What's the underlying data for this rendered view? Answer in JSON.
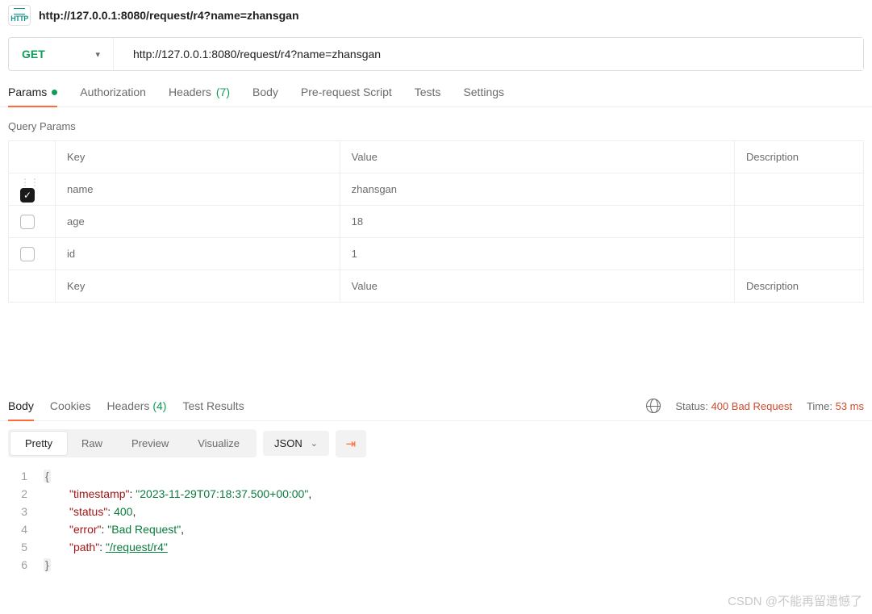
{
  "header": {
    "title_url": "http://127.0.0.1:8080/request/r4?name=zhansgan"
  },
  "request": {
    "method": "GET",
    "url": "http://127.0.0.1:8080/request/r4?name=zhansgan"
  },
  "tabs": {
    "params": "Params",
    "authorization": "Authorization",
    "headers": "Headers",
    "headers_count": "(7)",
    "body": "Body",
    "prerequest": "Pre-request Script",
    "tests": "Tests",
    "settings": "Settings"
  },
  "query_params": {
    "section_label": "Query Params",
    "headers": {
      "key": "Key",
      "value": "Value",
      "description": "Description"
    },
    "rows": [
      {
        "checked": true,
        "key": "name",
        "value": "zhansgan",
        "desc": ""
      },
      {
        "checked": false,
        "key": "age",
        "value": "18",
        "desc": ""
      },
      {
        "checked": false,
        "key": "id",
        "value": "1",
        "desc": ""
      }
    ],
    "placeholder": {
      "key": "Key",
      "value": "Value",
      "description": "Description"
    }
  },
  "response": {
    "tabs": {
      "body": "Body",
      "cookies": "Cookies",
      "headers": "Headers",
      "headers_count": "(4)",
      "test_results": "Test Results"
    },
    "meta": {
      "status_label": "Status:",
      "status_value": "400 Bad Request",
      "time_label": "Time:",
      "time_value": "53 ms"
    },
    "viewer": {
      "pretty": "Pretty",
      "raw": "Raw",
      "preview": "Preview",
      "visualize": "Visualize",
      "format": "JSON"
    },
    "json": {
      "l1": "{",
      "l2_key": "\"timestamp\"",
      "l2_val": "\"2023-11-29T07:18:37.500+00:00\"",
      "l3_key": "\"status\"",
      "l3_val": "400",
      "l4_key": "\"error\"",
      "l4_val": "\"Bad Request\"",
      "l5_key": "\"path\"",
      "l5_val": "\"/request/r4\"",
      "l6": "}"
    }
  },
  "watermark": "CSDN @不能再留遗憾了"
}
